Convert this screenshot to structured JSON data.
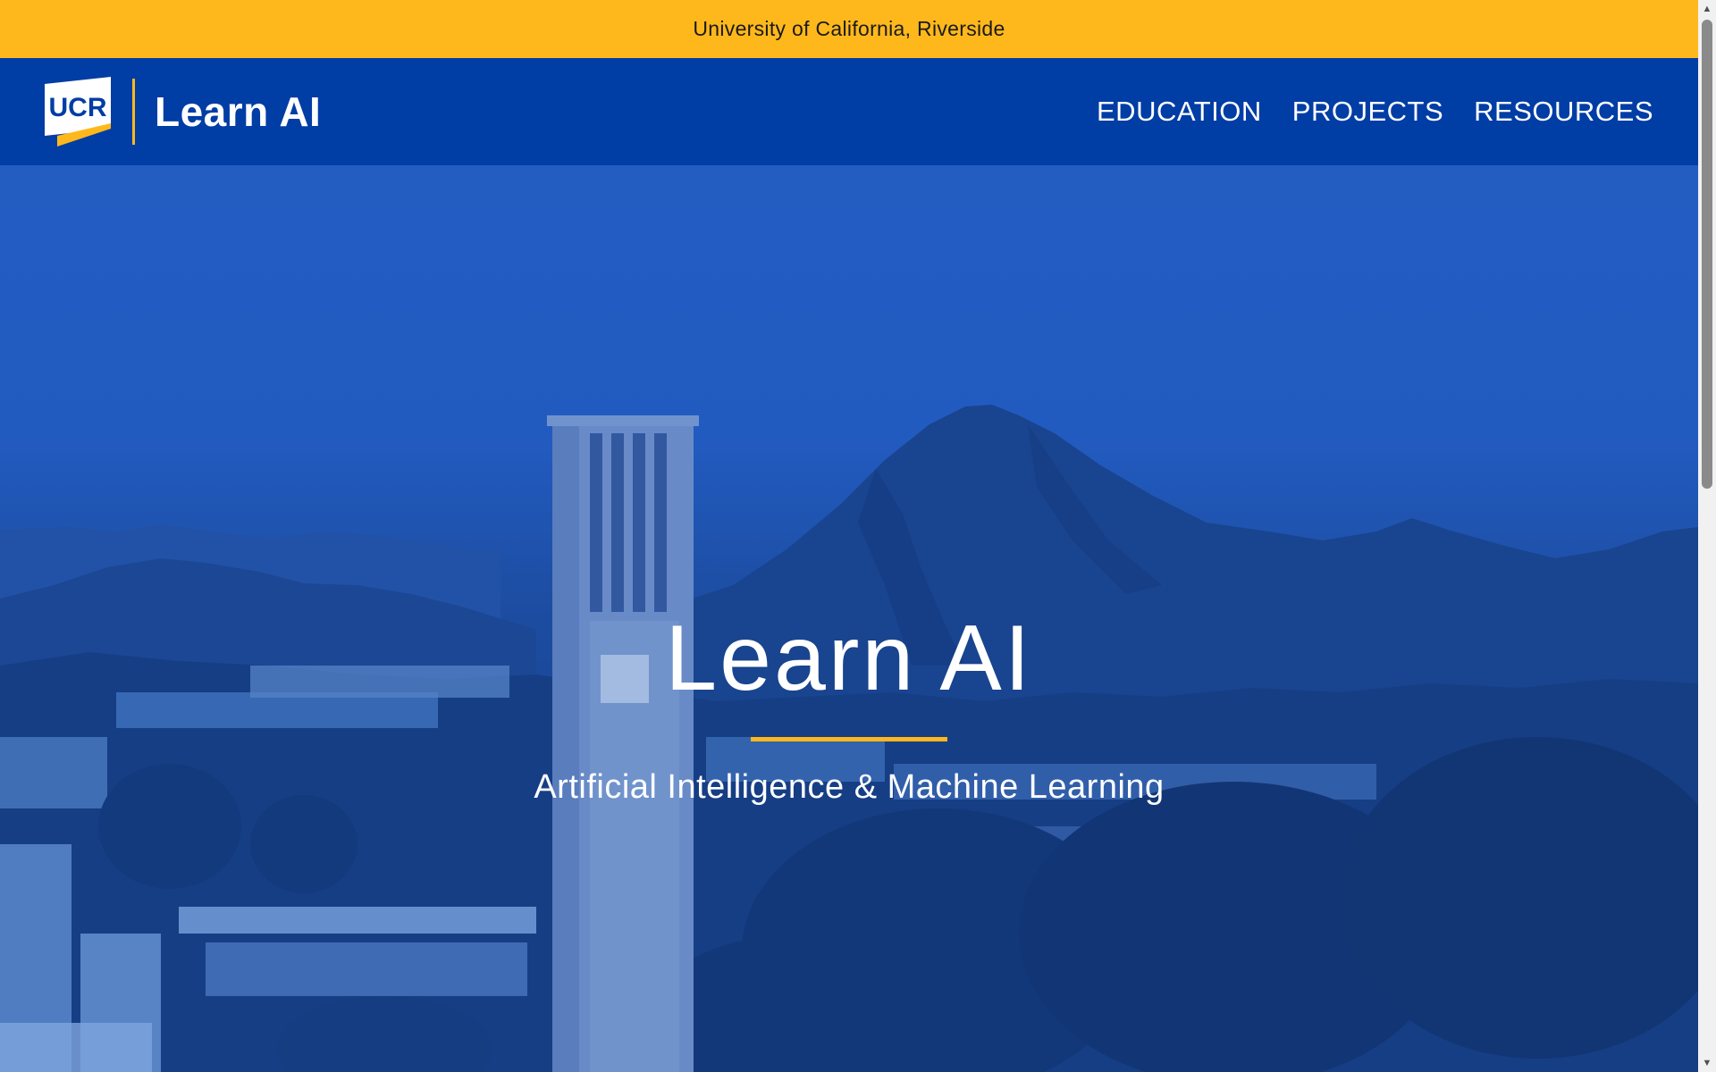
{
  "top_banner": {
    "text": "University of California, Riverside"
  },
  "header": {
    "logo_text": "UCR",
    "site_title": "Learn AI",
    "nav": [
      {
        "label": "EDUCATION"
      },
      {
        "label": "PROJECTS"
      },
      {
        "label": "RESOURCES"
      }
    ]
  },
  "hero": {
    "title": "Learn AI",
    "subtitle": "Artificial Intelligence & Machine Learning"
  },
  "colors": {
    "gold": "#ffb81c",
    "blue": "#003da5"
  }
}
